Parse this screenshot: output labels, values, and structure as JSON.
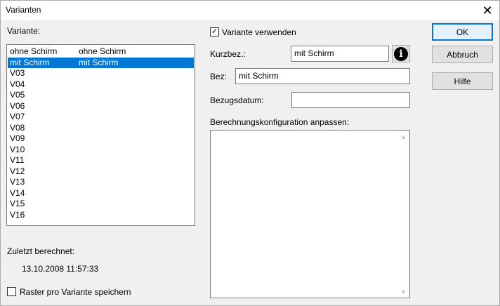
{
  "window": {
    "title": "Varianten",
    "close_glyph": "✕"
  },
  "left": {
    "variante_label": "Variante:",
    "items": [
      {
        "name": "ohne Schirm",
        "desc": "ohne Schirm",
        "selected": false
      },
      {
        "name": "mit Schirm",
        "desc": "mit Schirm",
        "selected": true
      },
      {
        "name": "V03",
        "desc": ""
      },
      {
        "name": "V04",
        "desc": ""
      },
      {
        "name": "V05",
        "desc": ""
      },
      {
        "name": "V06",
        "desc": ""
      },
      {
        "name": "V07",
        "desc": ""
      },
      {
        "name": "V08",
        "desc": ""
      },
      {
        "name": "V09",
        "desc": ""
      },
      {
        "name": "V10",
        "desc": ""
      },
      {
        "name": "V11",
        "desc": ""
      },
      {
        "name": "V12",
        "desc": ""
      },
      {
        "name": "V13",
        "desc": ""
      },
      {
        "name": "V14",
        "desc": ""
      },
      {
        "name": "V15",
        "desc": ""
      },
      {
        "name": "V16",
        "desc": ""
      }
    ],
    "zuletzt_label": "Zuletzt berechnet:",
    "zuletzt_value": "13.10.2008  11:57:33",
    "raster_label": "Raster pro Variante speichern",
    "raster_checked": false
  },
  "middle": {
    "verwenden_label": "Variante verwenden",
    "verwenden_checked": true,
    "check_glyph": "✓",
    "kurzbez_label": "Kurzbez.:",
    "kurzbez_value": "mit Schirm",
    "info_glyph": "i",
    "bez_label": "Bez:",
    "bez_value": "mit Schirm",
    "bezugsdatum_label": "Bezugsdatum:",
    "bezugsdatum_value": "",
    "berechnung_label": "Berechnungskonfiguration anpassen:",
    "berechnung_value": ""
  },
  "buttons": {
    "ok": "OK",
    "abbruch": "Abbruch",
    "hilfe": "Hilfe"
  }
}
